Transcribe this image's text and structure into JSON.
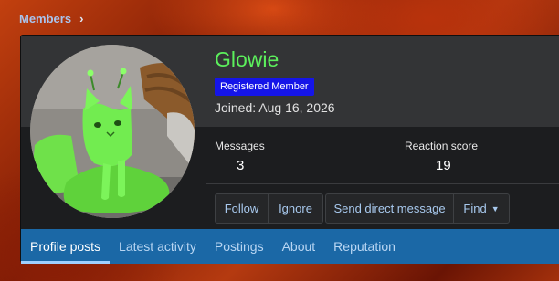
{
  "breadcrumb": {
    "label": "Members",
    "separator": "›"
  },
  "profile": {
    "username": "Glowie",
    "username_color": "#5cf05c",
    "role_badge": "Registered Member",
    "badge_color": "#1515e8",
    "joined_label": "Joined:",
    "joined_date": "Aug 16, 2026"
  },
  "stats": {
    "messages_label": "Messages",
    "messages_value": "3",
    "reaction_label": "Reaction score",
    "reaction_value": "19"
  },
  "actions": {
    "follow": "Follow",
    "ignore": "Ignore",
    "dm": "Send direct message",
    "find": "Find"
  },
  "tabs": [
    {
      "label": "Profile posts",
      "active": true
    },
    {
      "label": "Latest activity"
    },
    {
      "label": "Postings"
    },
    {
      "label": "About"
    },
    {
      "label": "Reputation"
    }
  ],
  "colors": {
    "accent": "#1b68a6",
    "link": "#a8c9ee"
  },
  "icons": {
    "avatar": "green-cat-avatar",
    "dropdown": "caret-down-icon"
  }
}
